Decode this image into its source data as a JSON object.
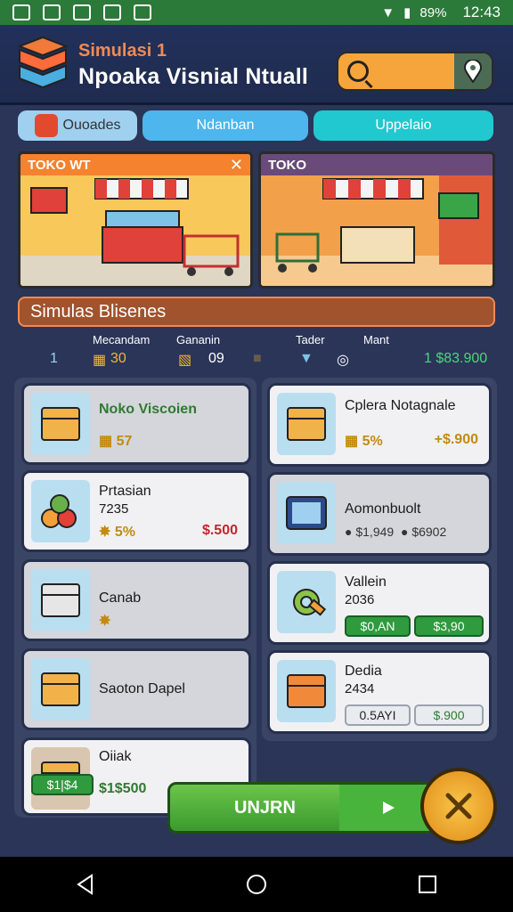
{
  "status_bar": {
    "battery": "89%",
    "time": "12:43"
  },
  "header": {
    "subtitle": "Simulasi 1",
    "title": "Npoaka Visnial Ntuall",
    "search": {
      "placeholder": "",
      "value": ""
    }
  },
  "tabs": [
    {
      "label": "Ouoades"
    },
    {
      "label": "Ndanban"
    },
    {
      "label": "Uppelaio"
    }
  ],
  "scenes": {
    "left_label": "TOKO WT",
    "right_label": "TOKO"
  },
  "banner": "Simulas Blisenes",
  "stats": {
    "labels": [
      "Mecandam",
      "Gananin",
      "Tader",
      "Mant"
    ],
    "col1_value": "1",
    "col2_value": "30",
    "col3_value": "09",
    "col4_value": "1 $83.900"
  },
  "products_left": [
    {
      "title": "Noko Viscoien",
      "meta": "57"
    },
    {
      "title": "Prtasian",
      "sub": "7235",
      "meta": "5%",
      "price": "$.500"
    },
    {
      "title": "Canab",
      "meta": ""
    },
    {
      "title": "Saoton Dapel"
    },
    {
      "title": "Oiiak",
      "badge": "$1|$4",
      "price": "$1$500"
    }
  ],
  "products_right": [
    {
      "title": "Cplera Notagnale",
      "meta": "5%",
      "price": "+$.900"
    },
    {
      "title": "Aomonbuolt",
      "meta1": "$1,949",
      "meta2": "$6902"
    },
    {
      "title": "Vallein",
      "sub": "2036",
      "pill1": "$0,AN",
      "pill2": "$3,90"
    },
    {
      "title": "Dedia",
      "sub": "2434",
      "pill1": "0.5AYI",
      "pill2": "$.900"
    }
  ],
  "actions": {
    "start_label": "UNJRN"
  },
  "colors": {
    "accent_orange": "#f08a55",
    "price_red": "#c0272d",
    "green": "#2f9a3e"
  }
}
